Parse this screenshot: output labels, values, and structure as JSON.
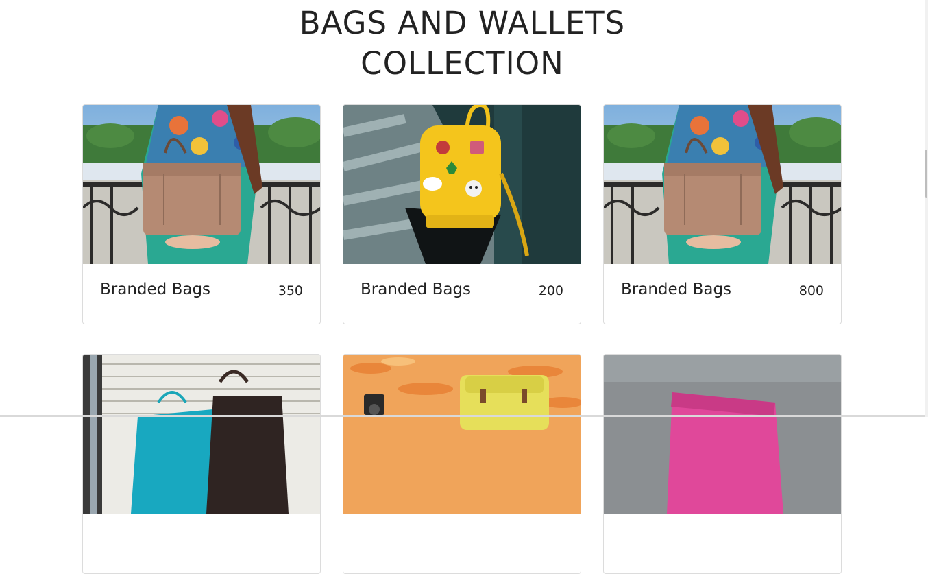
{
  "section": {
    "title_line1": "BAGS AND WALLETS",
    "title_line2": "COLLECTION"
  },
  "products": [
    {
      "name": "Branded Bags",
      "price": "350",
      "image": "woman-holding-tan-leather-handbag"
    },
    {
      "name": "Branded Bags",
      "price": "200",
      "image": "yellow-backpack-with-patches"
    },
    {
      "name": "Branded Bags",
      "price": "800",
      "image": "woman-holding-tan-leather-handbag"
    },
    {
      "image": "blue-and-black-tote-bags"
    },
    {
      "image": "yellow-satchel-and-camera-on-leaves"
    },
    {
      "image": "pink-leather-wallet"
    }
  ],
  "colors": {
    "text": "#222222",
    "card_border": "#dcdcdc",
    "background": "#ffffff"
  }
}
